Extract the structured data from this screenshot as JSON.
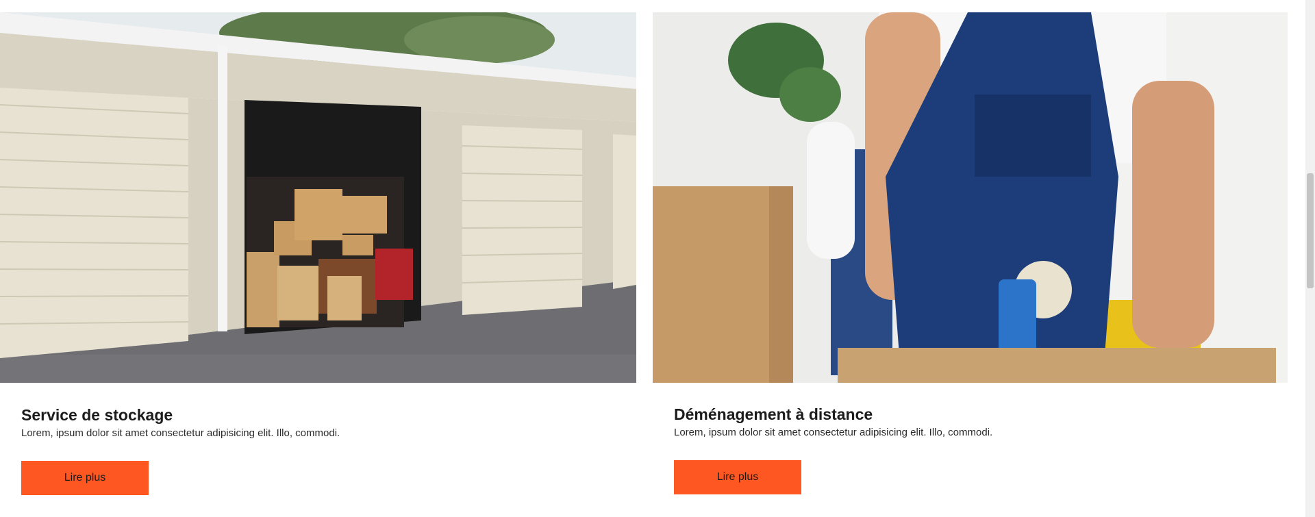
{
  "cards": [
    {
      "image": "storage-units-photo",
      "title": "Service de stockage",
      "description": "Lorem, ipsum dolor sit amet consectetur adipisicing elit. Illo, commodi.",
      "button_label": "Lire plus"
    },
    {
      "image": "mover-packing-box-photo",
      "title": "Déménagement à distance",
      "description": "Lorem, ipsum dolor sit amet consectetur adipisicing elit. Illo, commodi.",
      "button_label": "Lire plus"
    }
  ],
  "colors": {
    "accent": "#ff5722",
    "title": "#1c1c1c",
    "text": "#2a2a2a"
  }
}
